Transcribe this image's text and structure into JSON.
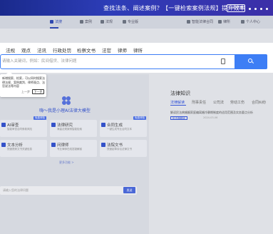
{
  "banner": {
    "text": "查找法条、阐述案例？【一键检索案例法规】提升效率",
    "button": "立即使用"
  },
  "topnav": {
    "items": [
      {
        "label": "法搜"
      },
      {
        "label": "案例"
      },
      {
        "label": "法规"
      },
      {
        "label": "专业版"
      },
      {
        "label": "智能法律合同"
      },
      {
        "label": "律所"
      },
      {
        "label": "个人中心"
      }
    ]
  },
  "search": {
    "tabs": [
      "法规",
      "观点",
      "法讯",
      "行政处罚",
      "检察文书",
      "法官",
      "律师",
      "律所"
    ],
    "placeholder": "请输入关键词，例如：民间借贷、法律问题"
  },
  "tooltip": {
    "text": "新增搜索、检索，可以同时搜索法律法规、案例裁判、律师观点、法官说法等内容",
    "prev": "上一步",
    "next": "下一步"
  },
  "assistant": {
    "title": "嗨～我是小理AI法律大模型",
    "cards": [
      {
        "title": "AI审查",
        "desc": "智能审查合同条款风险",
        "tag": "免费体验"
      },
      {
        "title": "法律研究",
        "desc": "海量法规案例智能检索",
        "tag": ""
      },
      {
        "title": "合同生成",
        "desc": "一键生成专业合同文本",
        "tag": "免费体验"
      },
      {
        "title": "文本分析",
        "desc": "快速提炼文书关键信息",
        "tag": ""
      },
      {
        "title": "问律师",
        "desc": "专业律师在线答疑解惑",
        "tag": ""
      },
      {
        "title": "法院文书",
        "desc": "快速起草诉讼法律文书",
        "tag": ""
      }
    ],
    "more": "更多功能 >",
    "input_placeholder": "请输入您的法律问题",
    "send": "发送"
  },
  "knowledge": {
    "title": "法律知识",
    "tabs": [
      "法律解读",
      "刑事责任",
      "公司法",
      "劳动工伤",
      "合同纠纷"
    ],
    "item_text": "解读民法典婚姻家庭编离婚冷静期制度的适用范围及实务要点分析",
    "item_badge": "民法典解读",
    "item_date": "2024-03-06"
  },
  "colors": {
    "accent": "#3d7ef5",
    "banner": "#2d3db8",
    "brand": "#3452c9"
  }
}
